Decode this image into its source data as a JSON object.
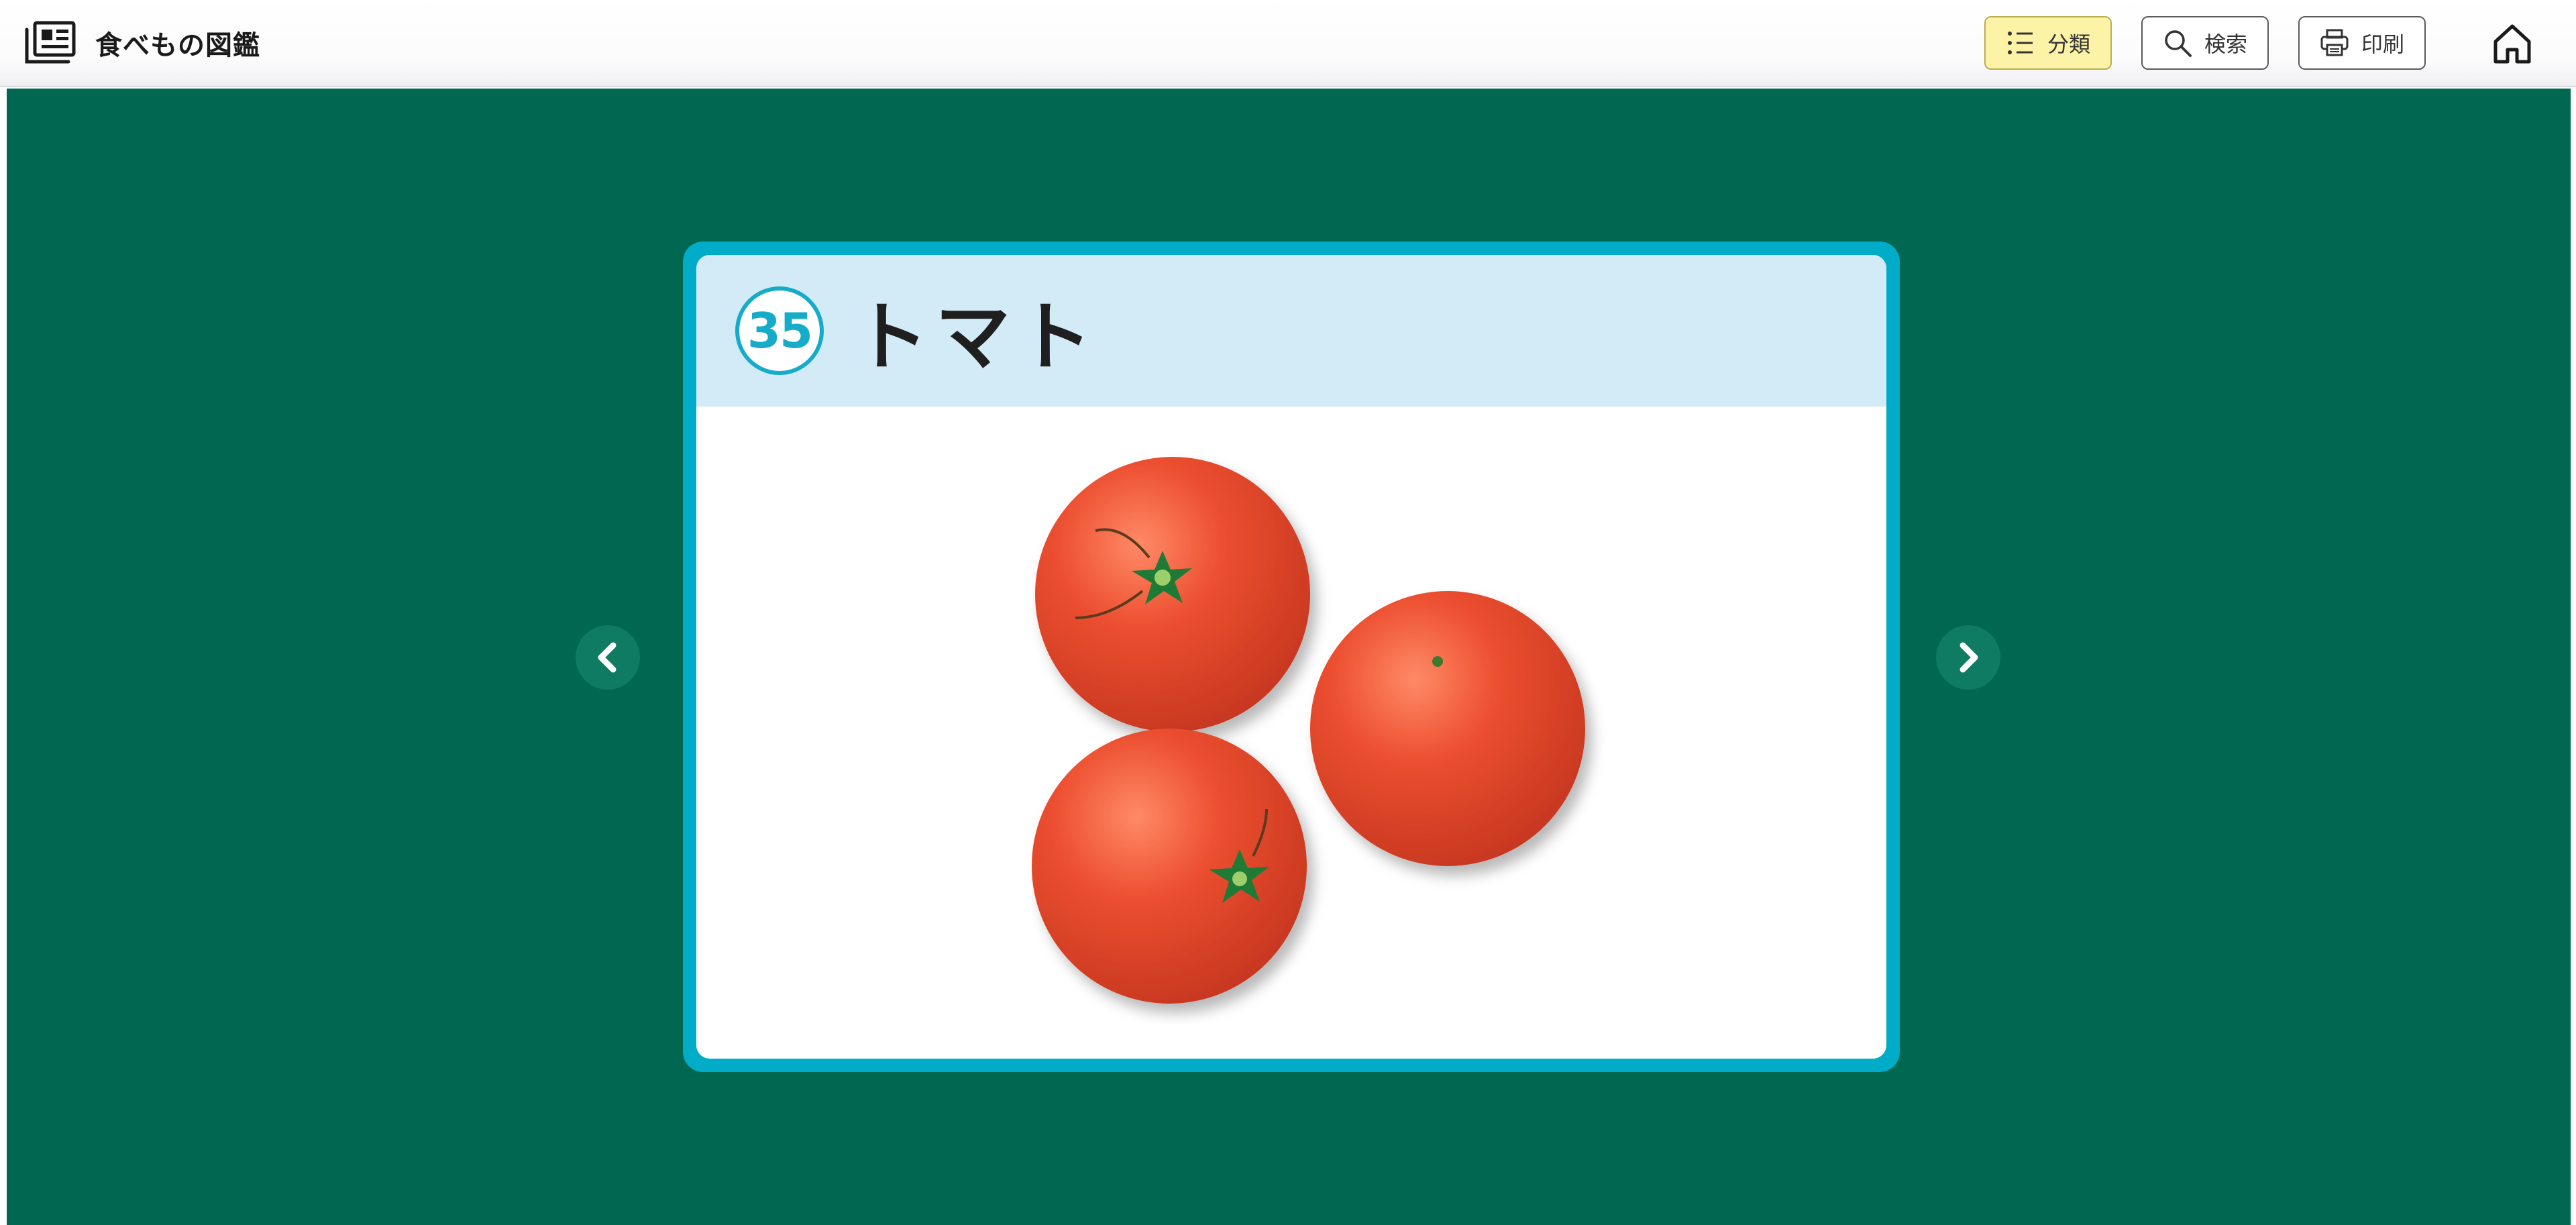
{
  "header": {
    "app_title": "食べもの図鑑",
    "buttons": {
      "classification": "分類",
      "search": "検索",
      "print": "印刷"
    }
  },
  "card": {
    "number": "35",
    "title": "トマト"
  },
  "icons": {
    "brand": "book-list-icon",
    "classification": "list-icon",
    "search": "search-icon",
    "print": "printer-icon",
    "home": "home-icon",
    "prev": "chevron-left-icon",
    "next": "chevron-right-icon"
  },
  "colors": {
    "stage_background": "#006850",
    "card_border": "#00acc7",
    "card_header": "#d2ebf7",
    "badge": "#16acc9",
    "active_button": "#fdf3a6",
    "tomato": "#e8452c"
  }
}
